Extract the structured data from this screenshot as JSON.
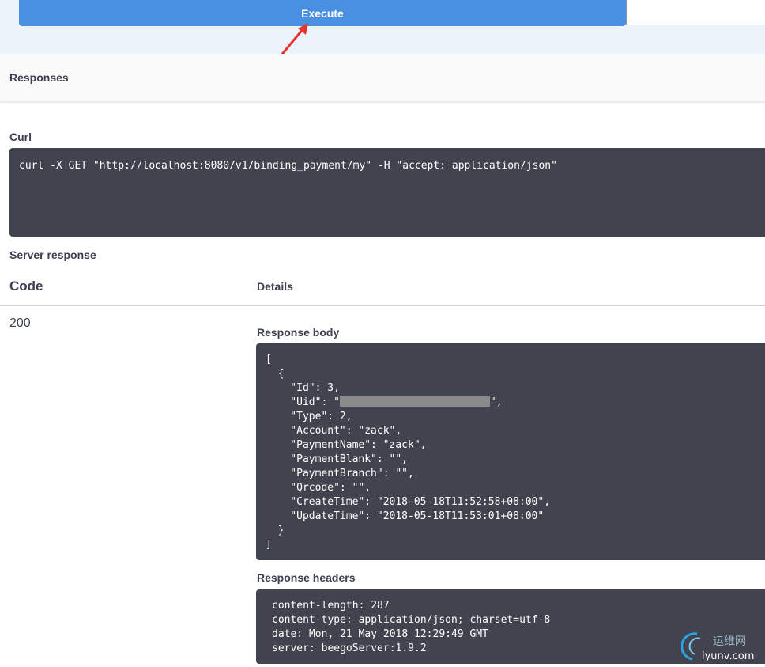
{
  "execute": {
    "label": "Execute"
  },
  "responses": {
    "title": "Responses"
  },
  "curl": {
    "label": "Curl",
    "command": "curl -X GET \"http://localhost:8080/v1/binding_payment/my\" -H \"accept: application/json\""
  },
  "server_response": {
    "label": "Server response",
    "col_code": "Code",
    "col_details": "Details",
    "status_code": "200",
    "body_label": "Response body",
    "body_lines": {
      "l0": "[",
      "l1": "  {",
      "l2": "    \"Id\": 3,",
      "l3_prefix": "    \"Uid\": \"",
      "l3_suffix": "\",",
      "l4": "    \"Type\": 2,",
      "l5": "    \"Account\": \"zack\",",
      "l6": "    \"PaymentName\": \"zack\",",
      "l7": "    \"PaymentBlank\": \"\",",
      "l8": "    \"PaymentBranch\": \"\",",
      "l9": "    \"Qrcode\": \"\",",
      "l10": "    \"CreateTime\": \"2018-05-18T11:52:58+08:00\",",
      "l11": "    \"UpdateTime\": \"2018-05-18T11:53:01+08:00\"",
      "l12": "  }",
      "l13": "]"
    },
    "headers_label": "Response headers",
    "header_lines": {
      "h0": "content-length: 287",
      "h1": "content-type: application/json; charset=utf-8",
      "h2": "date: Mon, 21 May 2018 12:29:49 GMT",
      "h3": "server: beegoServer:1.9.2"
    }
  },
  "watermark": {
    "text_cn": "运维网",
    "text_url": "iyunv.com"
  },
  "colors": {
    "execute_bg": "#4990e2",
    "code_bg": "#41444e",
    "band_bg": "#ebf3fb",
    "arrow": "#e8342f"
  }
}
